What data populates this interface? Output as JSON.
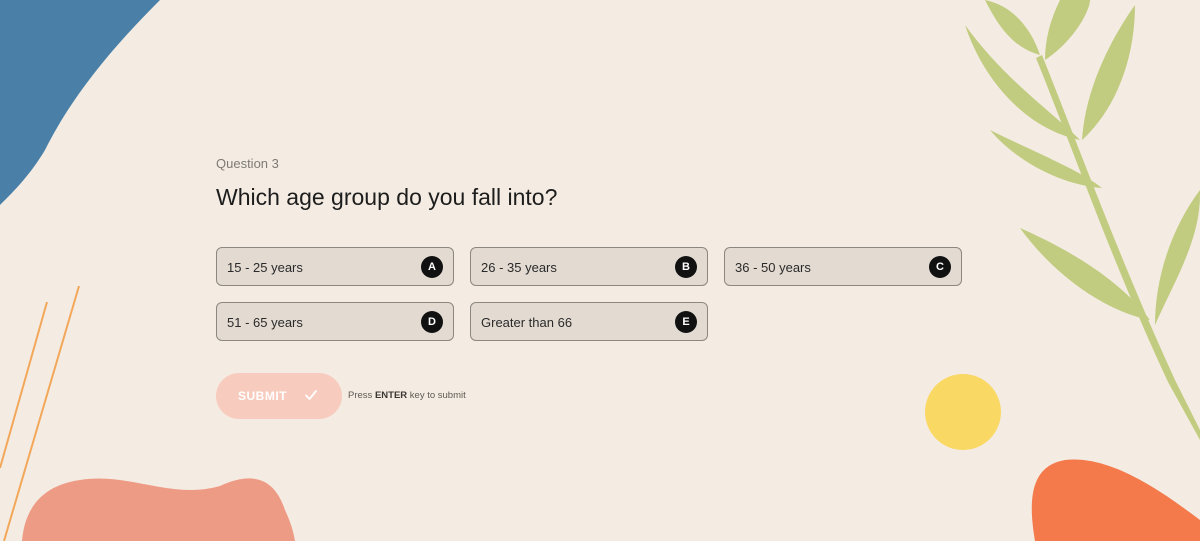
{
  "question": {
    "number_label": "Question 3",
    "title": "Which age group do you fall into?"
  },
  "options": [
    {
      "label": "15 - 25 years",
      "key": "A"
    },
    {
      "label": "26 - 35 years",
      "key": "B"
    },
    {
      "label": "36 - 50 years",
      "key": "C"
    },
    {
      "label": "51 - 65 years",
      "key": "D"
    },
    {
      "label": "Greater than 66",
      "key": "E"
    }
  ],
  "submit": {
    "label": "SUBMIT",
    "icon": "check-icon",
    "hint_prefix": "Press",
    "hint_key": "ENTER",
    "hint_suffix": "key to submit"
  },
  "colors": {
    "background": "#f4ece2",
    "submit_button": "#f7ccbe",
    "option_fill": "#dcd4cc",
    "key_badge": "#111111",
    "blue_shape": "#4a80a8",
    "salmon_shape": "#ee9b86",
    "orange_shape": "#f47a4c",
    "yellow_circle": "#fad864",
    "leaf_green": "#c2cc80",
    "line_orange": "#f3a75a"
  }
}
